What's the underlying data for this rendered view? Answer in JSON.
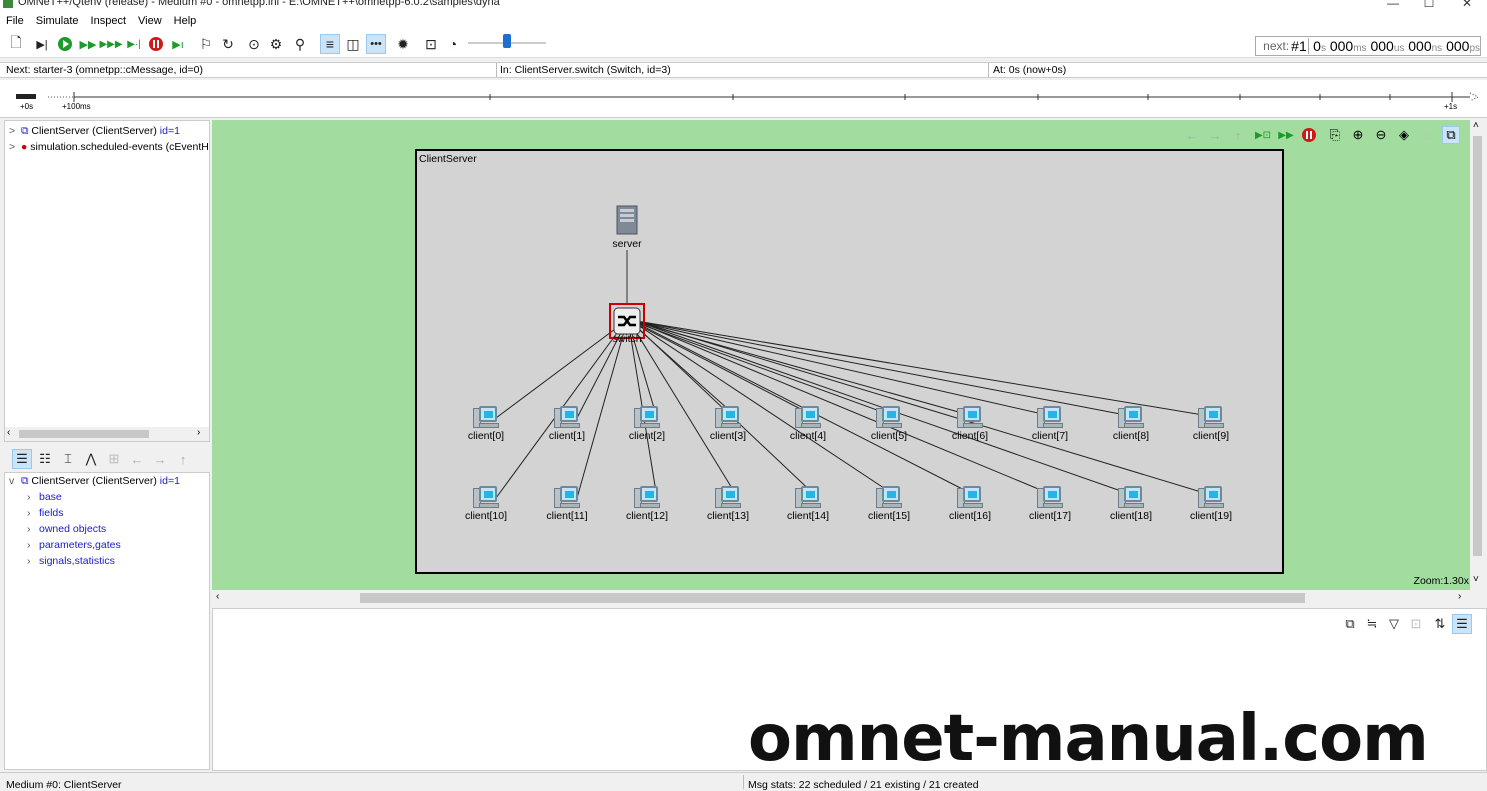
{
  "window": {
    "title": "OMNeT++/Qtenv (release) - Medium #0 - omnetpp.ini - E:\\OMNET++\\omnetpp-6.0.2\\samples\\dyna",
    "minimize": "—",
    "maximize": "☐",
    "close": "✕"
  },
  "menu": [
    "File",
    "Simulate",
    "Inspect",
    "View",
    "Help"
  ],
  "toolbar_icons": [
    "new-ini-icon",
    "step-icon",
    "run-icon",
    "fast-run-icon",
    "express-run-icon",
    "run-until-icon",
    "stop-icon",
    "debug-next-icon",
    "rebuild-network-icon",
    "restart-icon",
    "stop-simulation-icon",
    "find-objects-icon",
    "search-icon",
    "timeline-icon",
    "object-tree-icon",
    "animation-icon",
    "settings-icon",
    "record-video-icon",
    "speed-icon"
  ],
  "clock": {
    "next_label": "next:",
    "next_num": "#1",
    "t0": "0",
    "u0": "s",
    "t1": "000",
    "u1": "ms",
    "t2": "000",
    "u2": "us",
    "t3": "000",
    "u3": "ns",
    "t4": "000",
    "u4": "ps"
  },
  "infobar": {
    "next": "Next: starter-3 (omnetpp::cMessage, id=0)",
    "in": "In: ClientServer.switch (Switch, id=3)",
    "at": "At: 0s (now+0s)"
  },
  "timeline": {
    "label_start": "+0s",
    "label_100ms": "+100ms",
    "label_end": "+1s"
  },
  "tree": {
    "items": [
      {
        "arrow": ">",
        "name": "ClientServer (ClientServer)",
        "id": "id=1"
      },
      {
        "arrow": ">",
        "name": "simulation.scheduled-events (cEventH",
        "id": ""
      }
    ]
  },
  "objtree": {
    "root": {
      "arrow": "v",
      "name": "ClientServer (ClientServer)",
      "id": "id=1"
    },
    "children": [
      "base",
      "fields",
      "owned objects",
      "parameters,gates",
      "signals,statistics"
    ]
  },
  "network": {
    "module_label": "ClientServer",
    "server": "server",
    "switch": "switch",
    "clients": [
      "client[0]",
      "client[1]",
      "client[2]",
      "client[3]",
      "client[4]",
      "client[5]",
      "client[6]",
      "client[7]",
      "client[8]",
      "client[9]",
      "client[10]",
      "client[11]",
      "client[12]",
      "client[13]",
      "client[14]",
      "client[15]",
      "client[16]",
      "client[17]",
      "client[18]",
      "client[19]"
    ],
    "zoom": "Zoom:1.30x"
  },
  "status": {
    "left": "Medium #0: ClientServer",
    "right": "Msg stats: 22 scheduled / 21 existing / 21 created"
  },
  "watermark": "omnet-manual.com",
  "colors": {
    "canvas_bg": "#a2dd9f",
    "module_bg": "#d3d3d3",
    "selection": "#cc0000"
  }
}
